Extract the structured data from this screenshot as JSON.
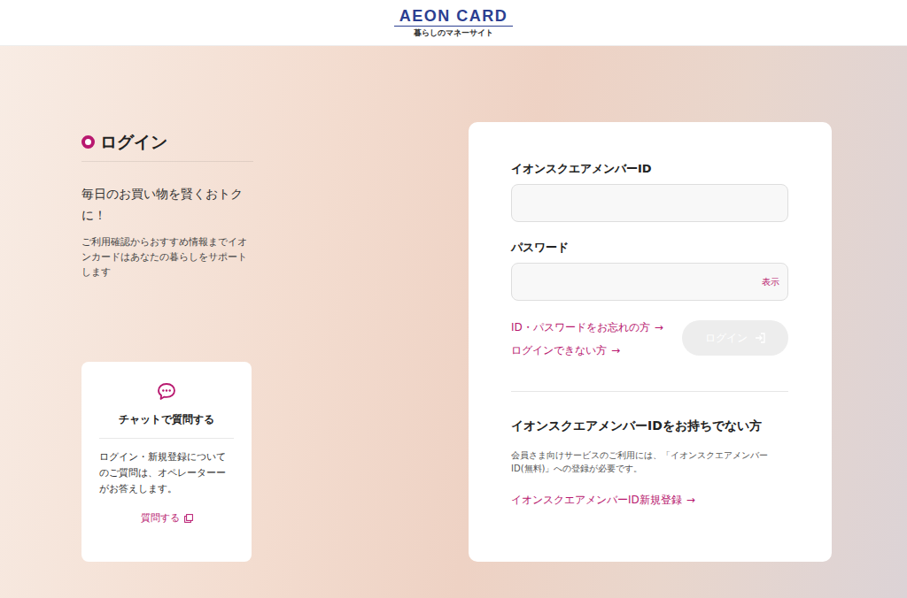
{
  "header": {
    "logo": "AEON CARD",
    "tagline": "暮らしのマネーサイト"
  },
  "intro": {
    "title": "ログイン",
    "headline": "毎日のお買い物を賢くおトクに！",
    "description": "ご利用確認からおすすめ情報までイオンカードはあなたの暮らしをサポートします"
  },
  "chat": {
    "title": "チャットで質問する",
    "body": "ログイン・新規登録についてのご質問は、オペレーターーがお答えします。",
    "link": "質問する"
  },
  "login_form": {
    "fields": [
      {
        "label": "イオンスクエアメンバーID",
        "value": "",
        "kind": "text"
      },
      {
        "label": "パスワード",
        "value": "",
        "kind": "password",
        "toggle": "表示"
      }
    ],
    "links": [
      {
        "label": "ID・パスワードをお忘れの方",
        "arrow": "→"
      },
      {
        "label": "ログインできない方",
        "arrow": "→"
      }
    ],
    "button": {
      "label": "ログイン",
      "disabled": true
    }
  },
  "register": {
    "title": "イオンスクエアメンバーIDをお持ちでない方",
    "note": "会員さま向けサービスのご利用には、「イオンスクエアメンバーID(無料)」への登録が必要です。",
    "link": {
      "label": "イオンスクエアメンバーID新規登録",
      "arrow": "→"
    }
  }
}
